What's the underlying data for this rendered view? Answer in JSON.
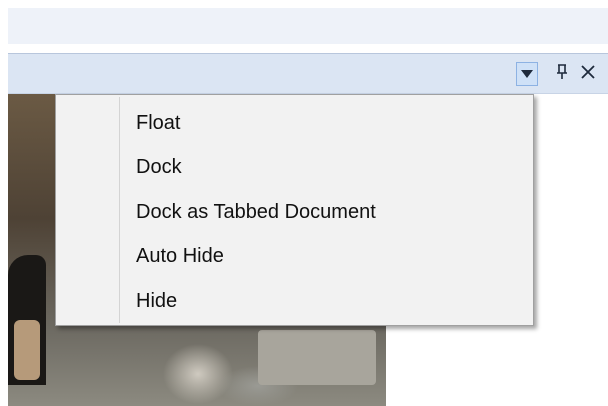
{
  "window": {
    "title_buttons": [
      {
        "name": "dropdown-arrow-icon",
        "glyph": "▼"
      },
      {
        "name": "pin-icon",
        "glyph": "ᛘ"
      },
      {
        "name": "close-icon",
        "glyph": "✕"
      }
    ]
  },
  "context_menu": {
    "items": [
      {
        "label": "Float"
      },
      {
        "label": "Dock"
      },
      {
        "label": "Dock as Tabbed Document"
      },
      {
        "label": "Auto Hide"
      },
      {
        "label": "Hide"
      }
    ]
  },
  "colors": {
    "titlebar": "#dbe5f3",
    "menu_background": "#f2f2f2",
    "dropdown_button_highlight": "#cfe1f7"
  }
}
